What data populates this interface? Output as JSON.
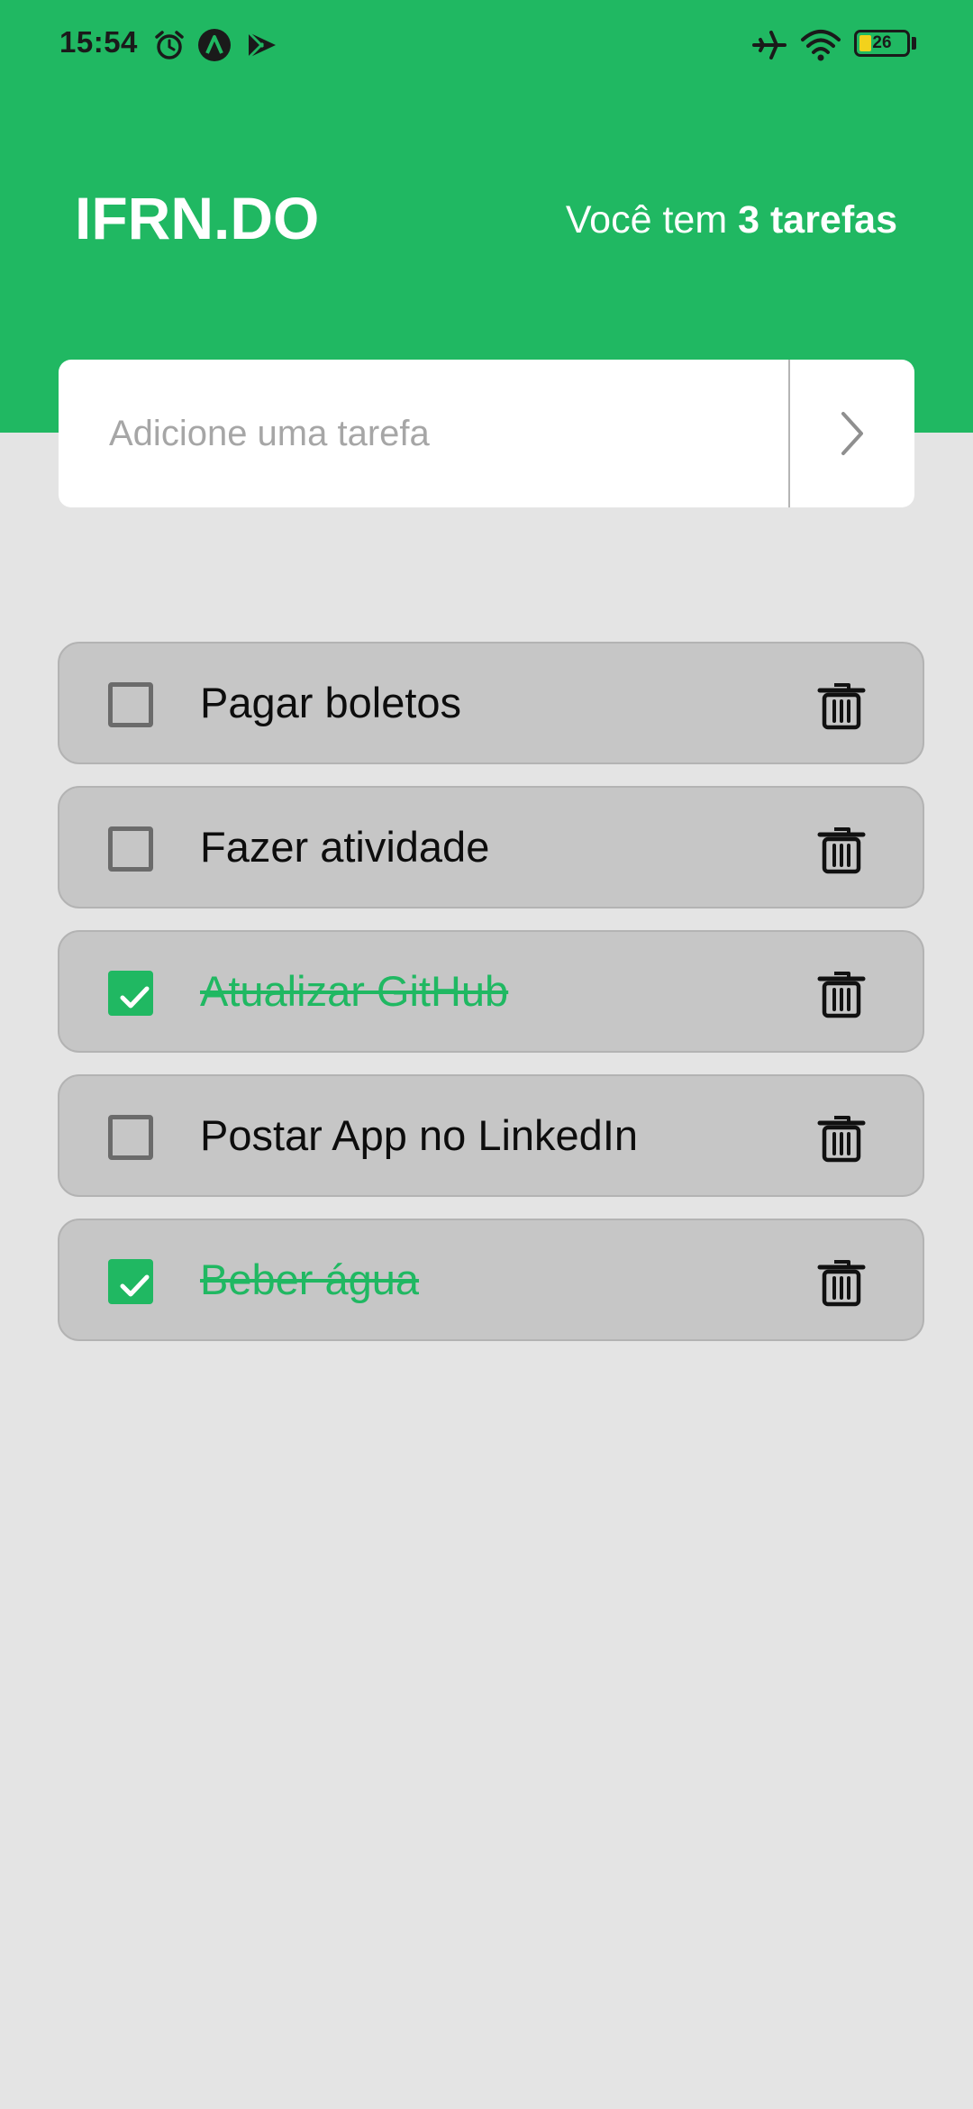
{
  "status_bar": {
    "time": "15:54",
    "icons": [
      "alarm-icon",
      "app-icon",
      "play-store-icon",
      "airplane-icon",
      "wifi-icon"
    ],
    "battery_level": "26",
    "battery_percent": 26
  },
  "header": {
    "title": "IFRN.DO",
    "counter_prefix": "Você tem ",
    "counter_value": "3 tarefas"
  },
  "new_task": {
    "placeholder": "Adicione uma tarefa",
    "value": "",
    "submit_icon": "chevron-right-icon"
  },
  "tasks": [
    {
      "label": "Pagar boletos",
      "done": false
    },
    {
      "label": "Fazer atividade",
      "done": false
    },
    {
      "label": "Atualizar GitHub",
      "done": true
    },
    {
      "label": "Postar App no LinkedIn",
      "done": false
    },
    {
      "label": "Beber água",
      "done": true
    }
  ],
  "colors": {
    "accent": "#20b862",
    "background": "#e4e4e4",
    "task_card": "#c6c6c6"
  }
}
